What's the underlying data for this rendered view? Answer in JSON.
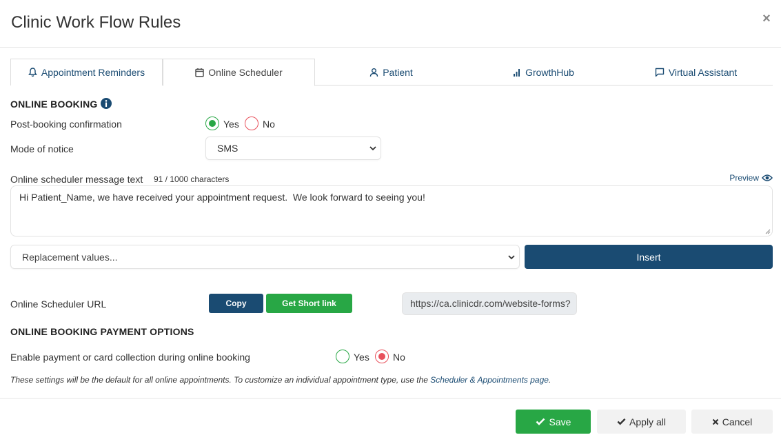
{
  "modal": {
    "title": "Clinic Work Flow Rules",
    "close_symbol": "×"
  },
  "tabs": [
    {
      "label": "Appointment Reminders",
      "icon": "bell-icon"
    },
    {
      "label": "Online Scheduler",
      "icon": "calendar-icon"
    },
    {
      "label": "Patient",
      "icon": "user-icon"
    },
    {
      "label": "GrowthHub",
      "icon": "bar-chart-icon"
    },
    {
      "label": "Virtual Assistant",
      "icon": "chat-icon"
    }
  ],
  "online_booking": {
    "title": "ONLINE BOOKING",
    "post_booking_label": "Post-booking confirmation",
    "post_booking_options": [
      "Yes",
      "No"
    ],
    "post_booking_selected": "Yes",
    "mode_label": "Mode of notice",
    "mode_value": "SMS",
    "message_label": "Online scheduler message text",
    "message_counter": "91 / 1000 characters",
    "preview_label": "Preview",
    "message_text": "Hi Patient_Name, we have received your appointment request.  We look forward to seeing you!",
    "replacement_placeholder": "Replacement values...",
    "insert_label": "Insert",
    "url_label": "Online Scheduler URL",
    "copy_label": "Copy",
    "short_link_label": "Get Short link",
    "url_value": "https://ca.clinicdr.com/website-forms?"
  },
  "payment": {
    "title": "ONLINE BOOKING PAYMENT OPTIONS",
    "enable_label": "Enable payment or card collection during online booking",
    "options": [
      "Yes",
      "No"
    ],
    "selected": "No",
    "note_text": "These settings will be the default for all online appointments. To customize an individual appointment type, use the ",
    "note_link": "Scheduler & Appointments page",
    "note_end": "."
  },
  "footer": {
    "save_label": "Save",
    "apply_all_label": "Apply all",
    "cancel_label": "Cancel"
  },
  "colors": {
    "navy": "#1a4b72",
    "green": "#28a745",
    "red": "#e8505b"
  }
}
